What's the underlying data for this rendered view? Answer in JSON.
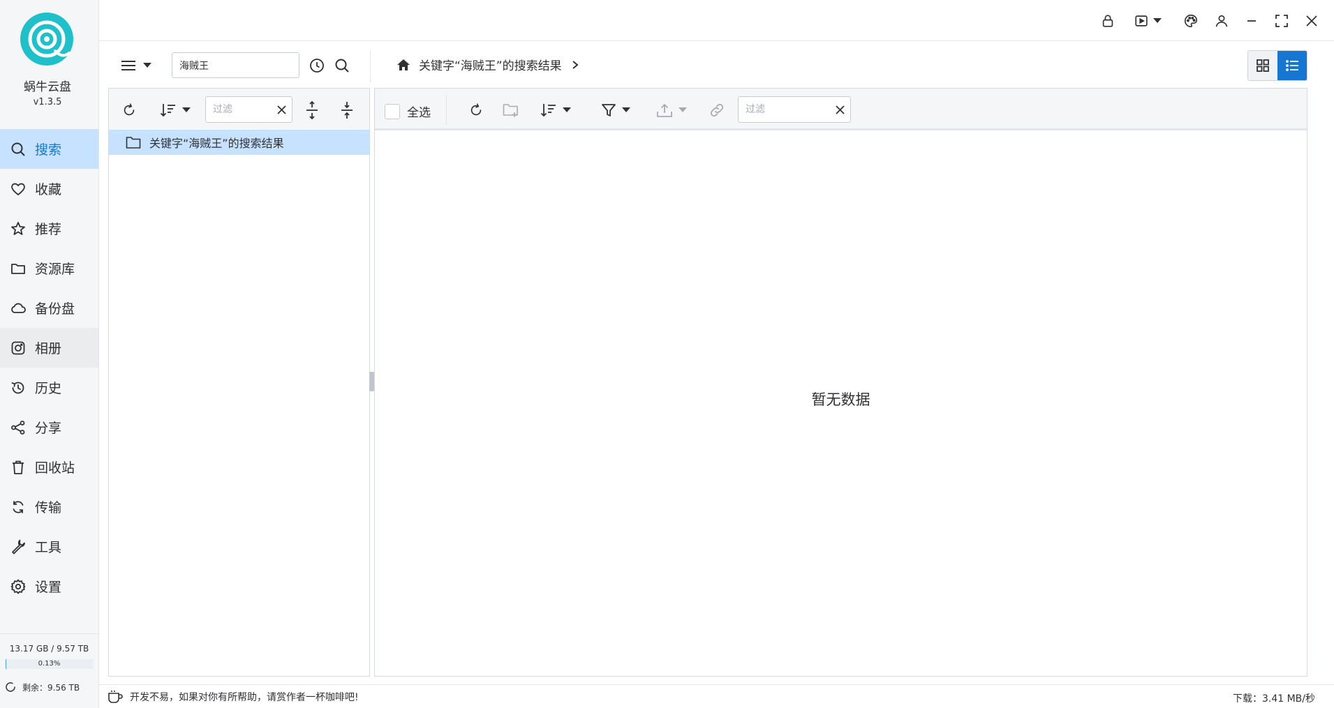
{
  "app": {
    "name": "蜗牛云盘",
    "version": "v1.3.5",
    "brand_color": "#1ec0c9"
  },
  "sidebar": {
    "items": [
      {
        "label": "搜索",
        "icon": "search-icon",
        "active": true
      },
      {
        "label": "收藏",
        "icon": "heart-icon"
      },
      {
        "label": "推荐",
        "icon": "star-icon"
      },
      {
        "label": "资源库",
        "icon": "folder-icon"
      },
      {
        "label": "备份盘",
        "icon": "cloud-icon"
      },
      {
        "label": "相册",
        "icon": "camera-icon"
      },
      {
        "label": "历史",
        "icon": "history-icon"
      },
      {
        "label": "分享",
        "icon": "share-icon"
      },
      {
        "label": "回收站",
        "icon": "trash-icon"
      },
      {
        "label": "传输",
        "icon": "sync-icon"
      },
      {
        "label": "工具",
        "icon": "wrench-icon"
      },
      {
        "label": "设置",
        "icon": "gear-icon"
      }
    ],
    "storage": {
      "text": "13.17 GB / 9.57 TB",
      "percent_label": "0.13%",
      "percent": 0.13
    },
    "remaining": "剩余：9.56 TB"
  },
  "toolbar": {
    "search_value": "海贼王",
    "breadcrumb": "关键字“海贼王”的搜索结果"
  },
  "tree": {
    "filter_placeholder": "过滤",
    "item_label": "关键字“海贼王”的搜索结果"
  },
  "files": {
    "select_all": "全选",
    "filter_placeholder": "过滤",
    "empty_text": "暂无数据"
  },
  "statusbar": {
    "message": "开发不易，如果对你有所帮助，请赏作者一杯咖啡吧!",
    "download_speed": "下载：3.41 MB/秒"
  },
  "colors": {
    "accent": "#1677d2",
    "active_bg": "#c6e2ff"
  }
}
